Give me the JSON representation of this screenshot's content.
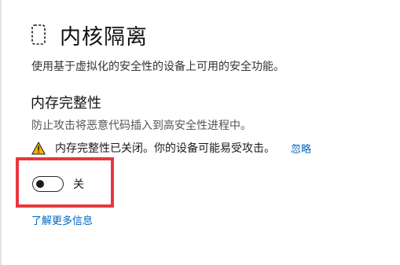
{
  "header": {
    "icon": "core-isolation-chip-icon",
    "title": "内核隔离"
  },
  "page_description": "使用基于虚拟化的安全性的设备上可用的安全功能。",
  "memory_integrity": {
    "title": "内存完整性",
    "description": "防止攻击将恶意代码插入到高安全性进程中。",
    "warning": {
      "icon": "warning-icon",
      "text": "内存完整性已关闭。你的设备可能易受攻击。",
      "dismiss_label": "忽略"
    },
    "toggle": {
      "state": "off",
      "label": "关"
    }
  },
  "learn_more_label": "了解更多信息",
  "colors": {
    "link": "#0067c0",
    "highlight_border": "#e8373f",
    "warning_fill": "#f2b400"
  }
}
